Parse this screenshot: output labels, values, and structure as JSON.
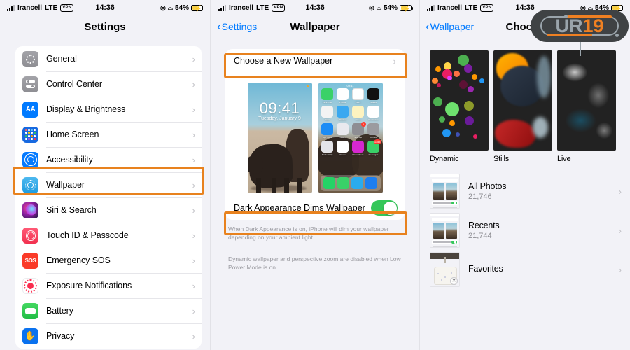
{
  "status_bar": {
    "carrier": "Irancell",
    "network": "LTE",
    "vpn_badge": "VPN",
    "time": "14:36",
    "battery_percent": "54%",
    "location_icon": "location-icon",
    "headphones_icon": "headphones-icon",
    "battery_icon": "battery-charging-icon",
    "signal_icon": "signal-bars-icon"
  },
  "panel1": {
    "nav": {
      "title": "Settings"
    },
    "items": [
      {
        "label": "General",
        "icon": "gear-icon"
      },
      {
        "label": "Control Center",
        "icon": "control-center-icon"
      },
      {
        "label": "Display & Brightness",
        "icon": "aa-icon"
      },
      {
        "label": "Home Screen",
        "icon": "home-screen-grid-icon"
      },
      {
        "label": "Accessibility",
        "icon": "accessibility-icon"
      },
      {
        "label": "Wallpaper",
        "icon": "wallpaper-icon"
      },
      {
        "label": "Siri & Search",
        "icon": "siri-icon"
      },
      {
        "label": "Touch ID & Passcode",
        "icon": "fingerprint-icon"
      },
      {
        "label": "Emergency SOS",
        "icon": "sos-icon"
      },
      {
        "label": "Exposure Notifications",
        "icon": "exposure-notifications-icon"
      },
      {
        "label": "Battery",
        "icon": "battery-icon"
      },
      {
        "label": "Privacy",
        "icon": "hand-icon"
      }
    ],
    "chevron": "›"
  },
  "panel2": {
    "nav": {
      "back": "Settings",
      "title": "Wallpaper",
      "back_chevron": "‹"
    },
    "choose_row": {
      "label": "Choose a New Wallpaper",
      "chevron": "›"
    },
    "preview": {
      "lock_time": "09:41",
      "lock_date": "Tuesday, January 9",
      "home_apps": [
        "FaceTime",
        "Photos",
        "Clock",
        "Stocks",
        "Maps",
        "Weather",
        "Notes",
        "Reminders",
        "App Store",
        "Wallet",
        "Settings",
        "Camera",
        "Productivity",
        "Chrome",
        "Home Store",
        "Messages"
      ],
      "dock_apps": [
        "WhatsApp",
        "Phone",
        "Telegram",
        "Bale"
      ],
      "badge_settings": "6",
      "badge_messages": "1153",
      "badge_whatsapp": "6"
    },
    "toggle": {
      "label": "Dark Appearance Dims Wallpaper",
      "state": "on"
    },
    "footnote1": "When Dark Appearance is on, iPhone will dim your wallpaper depending on your ambient light.",
    "footnote2": "Dynamic wallpaper and perspective zoom are disabled when Low Power Mode is on."
  },
  "panel3": {
    "nav": {
      "back": "Wallpaper",
      "title": "Choose",
      "back_chevron": "‹"
    },
    "categories": [
      {
        "label": "Dynamic"
      },
      {
        "label": "Stills"
      },
      {
        "label": "Live"
      }
    ],
    "albums": [
      {
        "title": "All Photos",
        "count": "21,746",
        "chevron": "›"
      },
      {
        "title": "Recents",
        "count": "21,744",
        "chevron": "›"
      },
      {
        "title": "Favorites",
        "count": "",
        "chevron": "›"
      }
    ]
  },
  "watermark": {
    "glyph_gray": "UR",
    "glyph_orange": "19"
  },
  "colors": {
    "highlight": "#e8821e",
    "accent_blue": "#007aff",
    "toggle_green": "#34c759",
    "background": "#f2f2f7"
  }
}
